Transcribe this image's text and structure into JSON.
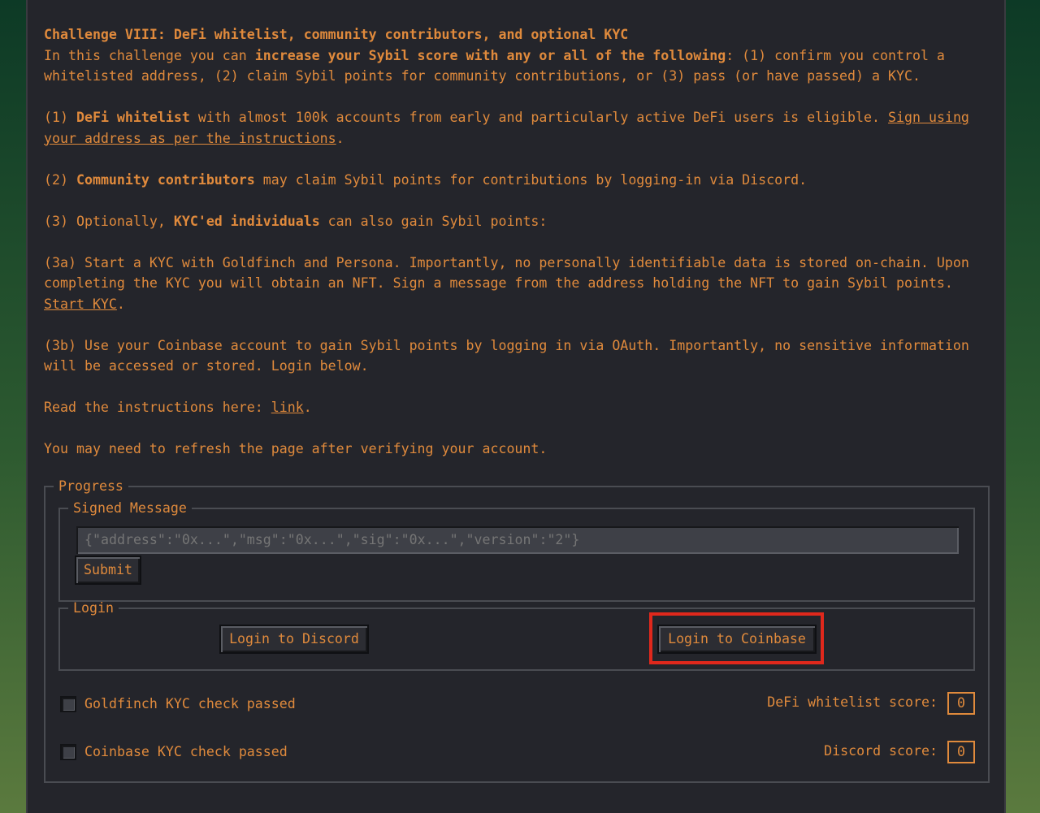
{
  "intro": {
    "title": "Challenge VIII: DeFi whitelist, community contributors, and optional KYC",
    "lead_before": "In this challenge you can ",
    "lead_bold": "increase your Sybil score with any or all of the following",
    "lead_after": ": (1) confirm you control a whitelisted address, (2) claim Sybil points for community contributions, or (3) pass (or have passed) a KYC."
  },
  "item1": {
    "prefix": "(1) ",
    "bold": "DeFi whitelist",
    "text": " with almost 100k accounts from early and particularly active DeFi users is eligible. ",
    "link": "Sign using your address as per the instructions",
    "suffix": "."
  },
  "item2": {
    "prefix": "(2) ",
    "bold": "Community contributors",
    "text": " may claim Sybil points for contributions by logging-in via Discord."
  },
  "item3": {
    "prefix": "(3) Optionally, ",
    "bold": "KYC'ed individuals",
    "text": " can also gain Sybil points:"
  },
  "item3a": {
    "text": "(3a) Start a KYC with Goldfinch and Persona. Importantly, no personally identifiable data is stored on-chain. Upon completing the KYC you will obtain an NFT. Sign a message from the address holding the NFT to gain Sybil points. ",
    "link": "Start KYC",
    "suffix": "."
  },
  "item3b": {
    "text": "(3b) Use your Coinbase account to gain Sybil points by logging in via OAuth. Importantly, no sensitive information will be accessed or stored. Login below."
  },
  "instructions": {
    "text": "Read the instructions here: ",
    "link": "link",
    "suffix": "."
  },
  "refresh_note": "You may need to refresh the page after verifying your account.",
  "progress": {
    "legend": "Progress",
    "signed": {
      "legend": "Signed Message",
      "placeholder": "{\"address\":\"0x...\",\"msg\":\"0x...\",\"sig\":\"0x...\",\"version\":\"2\"}",
      "submit_label": "Submit"
    },
    "login": {
      "legend": "Login",
      "discord_label": "Login to Discord",
      "coinbase_label": "Login to Coinbase"
    },
    "checks": {
      "goldfinch_label": "Goldfinch KYC check passed",
      "coinbase_label": "Coinbase KYC check passed"
    },
    "scores": {
      "defi_label": "DeFi whitelist score:",
      "defi_value": "0",
      "discord_label": "Discord score:",
      "discord_value": "0"
    }
  }
}
